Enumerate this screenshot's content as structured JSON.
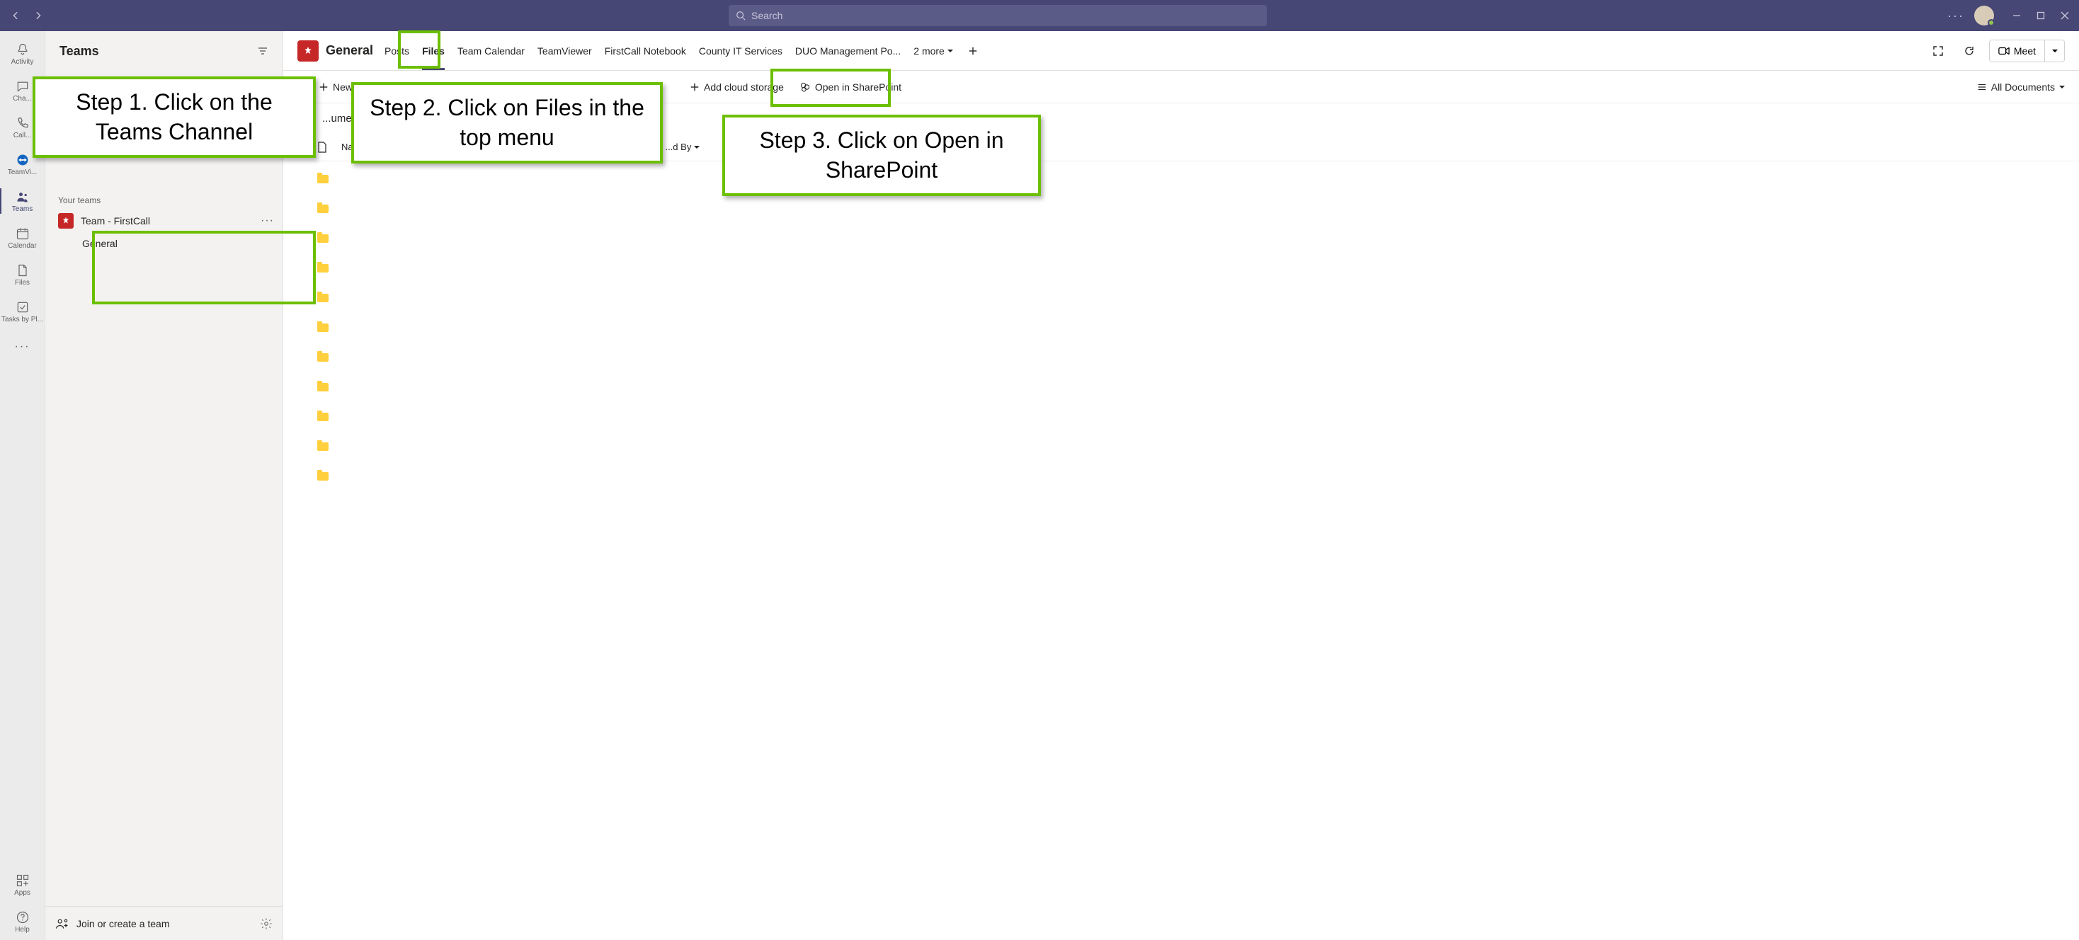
{
  "titlebar": {
    "search_placeholder": "Search"
  },
  "rail": {
    "activity": "Activity",
    "chat": "Cha...",
    "calls": "Call...",
    "teamviewer": "TeamVi...",
    "teams": "Teams",
    "calendar": "Calendar",
    "files": "Files",
    "tasks": "Tasks by Pl...",
    "apps": "Apps",
    "help": "Help"
  },
  "sidebar": {
    "title": "Teams",
    "your_teams": "Your teams",
    "team_name": "Team - FirstCall",
    "channel_general": "General",
    "join_team": "Join or create a team"
  },
  "channel_header": {
    "title": "General",
    "tabs": {
      "posts": "Posts",
      "files": "Files",
      "calendar": "Team Calendar",
      "teamviewer": "TeamViewer",
      "notebook": "FirstCall Notebook",
      "county": "County IT Services",
      "duo": "DUO Management Po..."
    },
    "more_tabs": "2 more",
    "meet": "Meet"
  },
  "toolbar": {
    "new": "New",
    "add_cloud": "Add cloud storage",
    "open_sharepoint": "Open in SharePoint",
    "all_documents": "All Documents"
  },
  "breadcrumb": {
    "documents": "...uments"
  },
  "columns": {
    "name": "Na...",
    "modified_by": "...d By"
  },
  "callouts": {
    "step1": "Step 1. Click on the Teams Channel",
    "step2": "Step 2. Click on Files in the top menu",
    "step3": "Step 3. Click on Open in SharePoint"
  },
  "folder_count": 11
}
